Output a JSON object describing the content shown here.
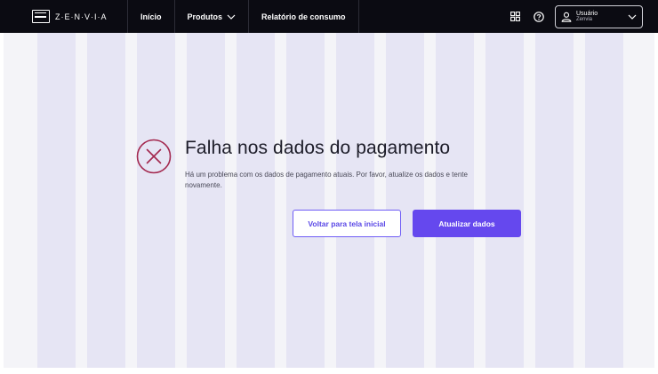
{
  "brand": {
    "logo_text": "Z·E·N·V·I·A"
  },
  "nav": {
    "items": [
      {
        "label": "Início"
      },
      {
        "label": "Produtos",
        "chevron": "∨"
      },
      {
        "label": "Relatório de consumo"
      }
    ]
  },
  "header_right": {
    "icons": [
      "apps-grid-icon",
      "help-icon"
    ],
    "user": {
      "name": "Usuário",
      "org": "Zenvia",
      "chevron": "∨"
    }
  },
  "error": {
    "title": "Falha nos dados do pagamento",
    "description": "Há um problema com os dados de pagamento atuais. Por favor, atualize os dados e tente novamente.",
    "icon": "error-circle-x-icon",
    "icon_color": "#a3284e"
  },
  "actions": {
    "secondary_label": "Voltar para tela inicial",
    "primary_label": "Atualizar dados"
  },
  "colors": {
    "navbar": "#0b0b12",
    "accent": "#6548ee",
    "background": "#f4f4f8",
    "grid_column": "#e6e5f4"
  }
}
